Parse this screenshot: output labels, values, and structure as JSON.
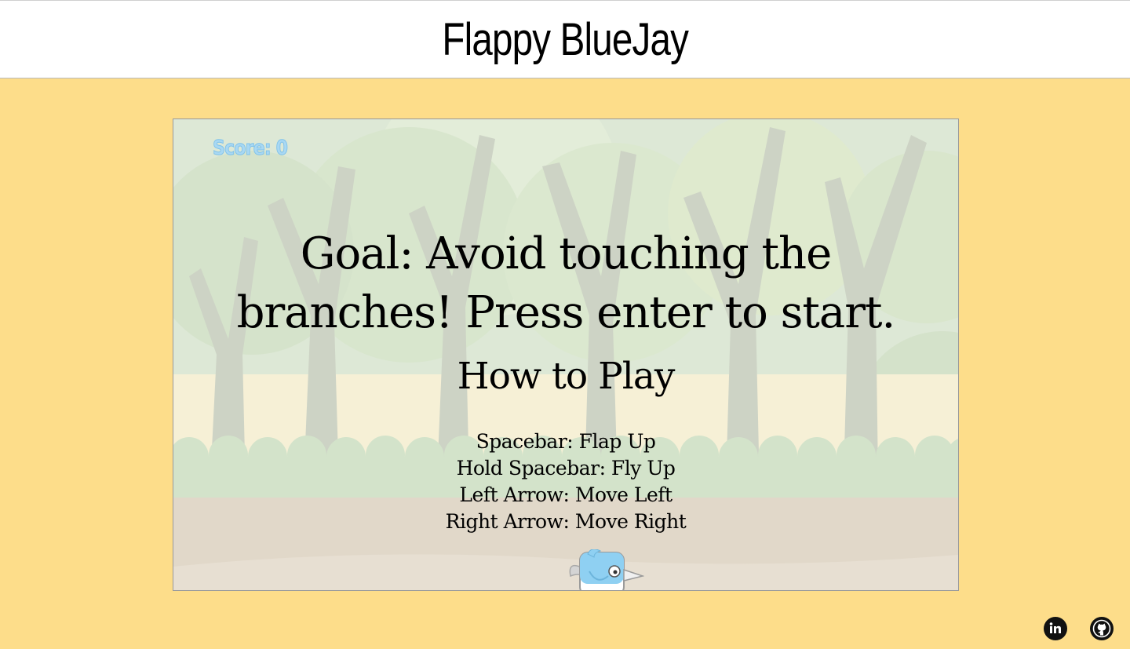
{
  "header": {
    "title": "Flappy BlueJay"
  },
  "game": {
    "score_label": "Score: 0",
    "goal_text": "Goal: Avoid touching the branches! Press enter to start.",
    "goal_line1": "Goal: Avoid touching the",
    "goal_line2": "branches! Press enter to start.",
    "howto_title": "How to Play",
    "controls": [
      "Spacebar: Flap Up",
      "Hold Spacebar: Fly Up",
      "Left Arrow: Move Left",
      "Right Arrow: Move Right"
    ]
  },
  "footer": {
    "icons": [
      "linkedin-icon",
      "github-icon"
    ]
  },
  "colors": {
    "page_background": "#fddd8a",
    "header_background": "#ffffff",
    "score_color": "#a9d8f3",
    "bird_blue": "#8fd0f2"
  }
}
